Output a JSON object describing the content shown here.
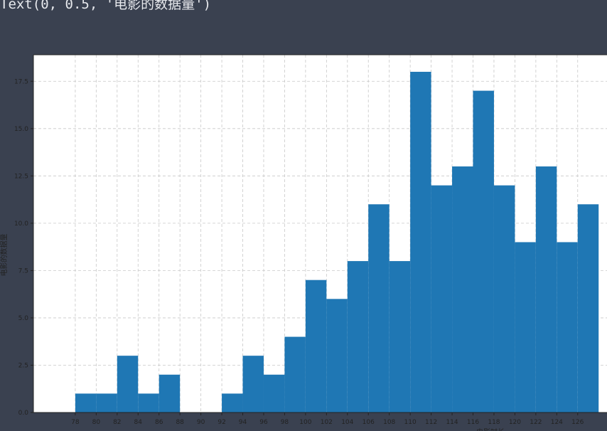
{
  "notebook": {
    "output_text": "Text(0, 0.5, '电影的数据量')"
  },
  "colors": {
    "bar": "#1f77b4",
    "grid": "#c8c8c8",
    "background": "#3a4150",
    "axes_face": "#ffffff"
  },
  "chart_data": {
    "type": "bar",
    "ylabel": "电影的数据量",
    "xlabel": "电影时长",
    "grid": true,
    "bin_width": 2,
    "xticks": [
      78,
      80,
      82,
      84,
      86,
      88,
      90,
      92,
      94,
      96,
      98,
      100,
      102,
      104,
      106,
      108,
      110,
      112,
      114,
      116,
      118,
      120,
      122,
      124,
      126
    ],
    "yticks": [
      0.0,
      2.5,
      5.0,
      7.5,
      10.0,
      12.5,
      15.0,
      17.5
    ],
    "ytick_labels": [
      "0.0",
      "2.5",
      "5.0",
      "7.5",
      "10.0",
      "12.5",
      "15.0",
      "17.5"
    ],
    "ylim": [
      0,
      18.9
    ],
    "xlim": [
      74,
      128.8
    ],
    "bins": [
      {
        "x0": 78,
        "x1": 80,
        "count": 1
      },
      {
        "x0": 80,
        "x1": 82,
        "count": 1
      },
      {
        "x0": 82,
        "x1": 84,
        "count": 3
      },
      {
        "x0": 84,
        "x1": 86,
        "count": 1
      },
      {
        "x0": 86,
        "x1": 88,
        "count": 2
      },
      {
        "x0": 88,
        "x1": 90,
        "count": 0
      },
      {
        "x0": 90,
        "x1": 92,
        "count": 0
      },
      {
        "x0": 92,
        "x1": 94,
        "count": 1
      },
      {
        "x0": 94,
        "x1": 96,
        "count": 3
      },
      {
        "x0": 96,
        "x1": 98,
        "count": 2
      },
      {
        "x0": 98,
        "x1": 100,
        "count": 4
      },
      {
        "x0": 100,
        "x1": 102,
        "count": 7
      },
      {
        "x0": 102,
        "x1": 104,
        "count": 6
      },
      {
        "x0": 104,
        "x1": 106,
        "count": 8
      },
      {
        "x0": 106,
        "x1": 108,
        "count": 11
      },
      {
        "x0": 108,
        "x1": 110,
        "count": 8
      },
      {
        "x0": 110,
        "x1": 112,
        "count": 18
      },
      {
        "x0": 112,
        "x1": 114,
        "count": 12
      },
      {
        "x0": 114,
        "x1": 116,
        "count": 13
      },
      {
        "x0": 116,
        "x1": 118,
        "count": 17
      },
      {
        "x0": 118,
        "x1": 120,
        "count": 12
      },
      {
        "x0": 120,
        "x1": 122,
        "count": 9
      },
      {
        "x0": 122,
        "x1": 124,
        "count": 13
      },
      {
        "x0": 124,
        "x1": 126,
        "count": 9
      },
      {
        "x0": 126,
        "x1": 128,
        "count": 11
      }
    ]
  }
}
